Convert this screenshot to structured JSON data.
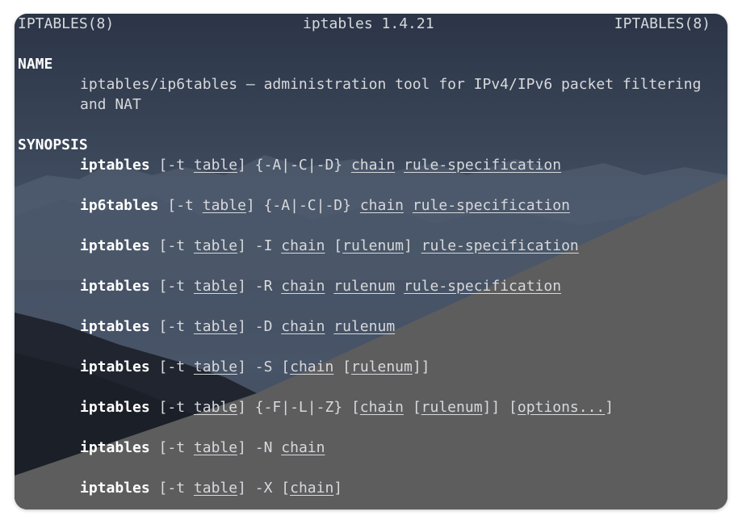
{
  "header": {
    "left": "IPTABLES(8)",
    "center": "iptables 1.4.21",
    "right": "IPTABLES(8)"
  },
  "name_section": {
    "heading": "NAME",
    "line1": "iptables/ip6tables — administration tool for IPv4/IPv6 packet filtering",
    "line2": "and NAT"
  },
  "synopsis_section": {
    "heading": "SYNOPSIS",
    "lines": [
      [
        {
          "t": "iptables",
          "s": "b"
        },
        {
          "t": " [-t ",
          "s": "plain"
        },
        {
          "t": "table",
          "s": "u"
        },
        {
          "t": "] {-A|-C|-D} ",
          "s": "plain"
        },
        {
          "t": "chain",
          "s": "u"
        },
        {
          "t": " ",
          "s": "plain"
        },
        {
          "t": "rule-specification",
          "s": "u"
        }
      ],
      [
        {
          "t": "ip6tables",
          "s": "b"
        },
        {
          "t": " [-t ",
          "s": "plain"
        },
        {
          "t": "table",
          "s": "u"
        },
        {
          "t": "] {-A|-C|-D} ",
          "s": "plain"
        },
        {
          "t": "chain",
          "s": "u"
        },
        {
          "t": " ",
          "s": "plain"
        },
        {
          "t": "rule-specification",
          "s": "u"
        }
      ],
      [
        {
          "t": "iptables",
          "s": "b"
        },
        {
          "t": " [-t ",
          "s": "plain"
        },
        {
          "t": "table",
          "s": "u"
        },
        {
          "t": "] -I ",
          "s": "plain"
        },
        {
          "t": "chain",
          "s": "u"
        },
        {
          "t": " [",
          "s": "plain"
        },
        {
          "t": "rulenum",
          "s": "u"
        },
        {
          "t": "] ",
          "s": "plain"
        },
        {
          "t": "rule-specification",
          "s": "u"
        }
      ],
      [
        {
          "t": "iptables",
          "s": "b"
        },
        {
          "t": " [-t ",
          "s": "plain"
        },
        {
          "t": "table",
          "s": "u"
        },
        {
          "t": "] -R ",
          "s": "plain"
        },
        {
          "t": "chain",
          "s": "u"
        },
        {
          "t": " ",
          "s": "plain"
        },
        {
          "t": "rulenum",
          "s": "u"
        },
        {
          "t": " ",
          "s": "plain"
        },
        {
          "t": "rule-specification",
          "s": "u"
        }
      ],
      [
        {
          "t": "iptables",
          "s": "b"
        },
        {
          "t": " [-t ",
          "s": "plain"
        },
        {
          "t": "table",
          "s": "u"
        },
        {
          "t": "] -D ",
          "s": "plain"
        },
        {
          "t": "chain",
          "s": "u"
        },
        {
          "t": " ",
          "s": "plain"
        },
        {
          "t": "rulenum",
          "s": "u"
        }
      ],
      [
        {
          "t": "iptables",
          "s": "b"
        },
        {
          "t": " [-t ",
          "s": "plain"
        },
        {
          "t": "table",
          "s": "u"
        },
        {
          "t": "] -S [",
          "s": "plain"
        },
        {
          "t": "chain",
          "s": "u"
        },
        {
          "t": " [",
          "s": "plain"
        },
        {
          "t": "rulenum",
          "s": "u"
        },
        {
          "t": "]]",
          "s": "plain"
        }
      ],
      [
        {
          "t": "iptables",
          "s": "b"
        },
        {
          "t": " [-t ",
          "s": "plain"
        },
        {
          "t": "table",
          "s": "u"
        },
        {
          "t": "] {-F|-L|-Z} [",
          "s": "plain"
        },
        {
          "t": "chain",
          "s": "u"
        },
        {
          "t": " [",
          "s": "plain"
        },
        {
          "t": "rulenum",
          "s": "u"
        },
        {
          "t": "]] [",
          "s": "plain"
        },
        {
          "t": "options...",
          "s": "u"
        },
        {
          "t": "]",
          "s": "plain"
        }
      ],
      [
        {
          "t": "iptables",
          "s": "b"
        },
        {
          "t": " [-t ",
          "s": "plain"
        },
        {
          "t": "table",
          "s": "u"
        },
        {
          "t": "] -N ",
          "s": "plain"
        },
        {
          "t": "chain",
          "s": "u"
        }
      ],
      [
        {
          "t": "iptables",
          "s": "b"
        },
        {
          "t": " [-t ",
          "s": "plain"
        },
        {
          "t": "table",
          "s": "u"
        },
        {
          "t": "] -X [",
          "s": "plain"
        },
        {
          "t": "chain",
          "s": "u"
        },
        {
          "t": "]",
          "s": "plain"
        }
      ]
    ]
  },
  "colors": {
    "bold_text": "#ffffff",
    "normal_text": "#d7d9dc",
    "sky_top": "#2c3648",
    "gray_overlay": "#5d5d5e"
  }
}
